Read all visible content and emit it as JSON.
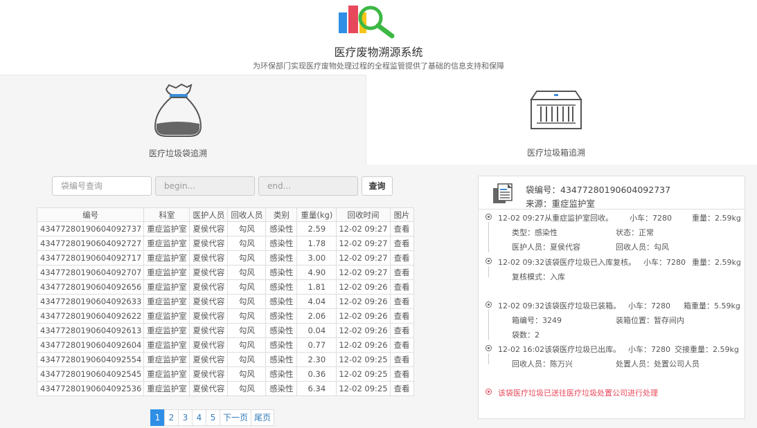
{
  "header": {
    "title": "医疗废物溯源系统",
    "subtitle": "为环保部门实现医疗废物处理过程的全程监管提供了基础的信息支持和保障"
  },
  "tabs": {
    "bag": {
      "label": "医疗垃圾袋追溯",
      "icon": "bag-icon"
    },
    "box": {
      "label": "医疗垃圾箱追溯",
      "icon": "container-icon"
    }
  },
  "search": {
    "bag_placeholder": "袋编号查询",
    "begin_placeholder": "begin...",
    "end_placeholder": "end...",
    "query_label": "查询"
  },
  "table": {
    "headers": [
      "编号",
      "科室",
      "医护人员",
      "回收人员",
      "类别",
      "重量(kg)",
      "回收时间",
      "图片"
    ],
    "rows": [
      [
        "4347728019060409273​7",
        "重症监护室",
        "夏侯代容",
        "勾风",
        "感染性",
        "2.59",
        "12-02 09:27",
        "查看"
      ],
      [
        "43477280190604092727",
        "重症监护室",
        "夏侯代容",
        "勾风",
        "感染性",
        "1.78",
        "12-02 09:27",
        "查看"
      ],
      [
        "43477280190604092717",
        "重症监护室",
        "夏侯代容",
        "勾风",
        "感染性",
        "3.00",
        "12-02 09:27",
        "查看"
      ],
      [
        "43477280190604092707",
        "重症监护室",
        "夏侯代容",
        "勾风",
        "感染性",
        "4.90",
        "12-02 09:27",
        "查看"
      ],
      [
        "43477280190604092656",
        "重症监护室",
        "夏侯代容",
        "勾风",
        "感染性",
        "1.81",
        "12-02 09:26",
        "查看"
      ],
      [
        "43477280190604092633",
        "重症监护室",
        "夏侯代容",
        "勾风",
        "感染性",
        "4.04",
        "12-02 09:26",
        "查看"
      ],
      [
        "43477280190604092622",
        "重症监护室",
        "夏侯代容",
        "勾风",
        "感染性",
        "2.06",
        "12-02 09:26",
        "查看"
      ],
      [
        "43477280190604092613",
        "重症监护室",
        "夏侯代容",
        "勾风",
        "感染性",
        "0.04",
        "12-02 09:26",
        "查看"
      ],
      [
        "43477280190604092604",
        "重症监护室",
        "夏侯代容",
        "勾风",
        "感染性",
        "0.77",
        "12-02 09:26",
        "查看"
      ],
      [
        "43477280190604092554",
        "重症监护室",
        "夏侯代容",
        "勾风",
        "感染性",
        "2.30",
        "12-02 09:25",
        "查看"
      ],
      [
        "43477280190604092545",
        "重症监护室",
        "夏侯代容",
        "勾风",
        "感染性",
        "0.36",
        "12-02 09:25",
        "查看"
      ],
      [
        "43477280190604092536",
        "重症监护室",
        "夏侯代容",
        "勾风",
        "感染性",
        "6.34",
        "12-02 09:25",
        "查看"
      ]
    ]
  },
  "pagination": {
    "pages": [
      "1",
      "2",
      "3",
      "4",
      "5"
    ],
    "active": "1",
    "next_label": "下一页",
    "last_label": "尾页"
  },
  "trace": {
    "bag_no": "袋编号：43477280190604092737",
    "source": "来源：重症监护室",
    "events": {
      "e1": {
        "title": "12-02 09:27从重症监护室回收。",
        "cart": "小车：7280",
        "weight": "重量：2.59kg",
        "type": "类型：感染性",
        "status": "状态：正常",
        "staff": "医护人员：夏侯代容",
        "collector": "回收人员：勾风"
      },
      "e2": {
        "title": "12-02 09:32该袋医疗垃圾已入库复核。",
        "cart": "小车：7280",
        "weight": "重量：2.59kg",
        "mode": "复核模式：入库"
      },
      "e3": {
        "title": "12-02 09:32该袋医疗垃圾已装箱。",
        "cart": "小车：7280",
        "box_weight": "箱重量：5.59kg",
        "box_no": "箱编号：3249",
        "box_pos": "装箱位置：暂存间内",
        "bag_count": "袋数：2"
      },
      "e4": {
        "title": "12-02 16:02该袋医疗垃圾已出库。",
        "cart": "小车：7280",
        "handover_weight": "交接重量：2.59kg",
        "collector": "回收人员：陈万兴",
        "handler": "处置人员：处置公司人员"
      },
      "final": "该袋医疗垃圾已送往医疗垃圾处置公司进行处理"
    }
  },
  "colors": {
    "accent_blue": "#2f8fe6",
    "alert_red": "#e8485b",
    "logo_red": "#e8485b",
    "logo_yellow": "#f5c518",
    "logo_blue": "#2f8fe6",
    "logo_green": "#3cb844"
  }
}
